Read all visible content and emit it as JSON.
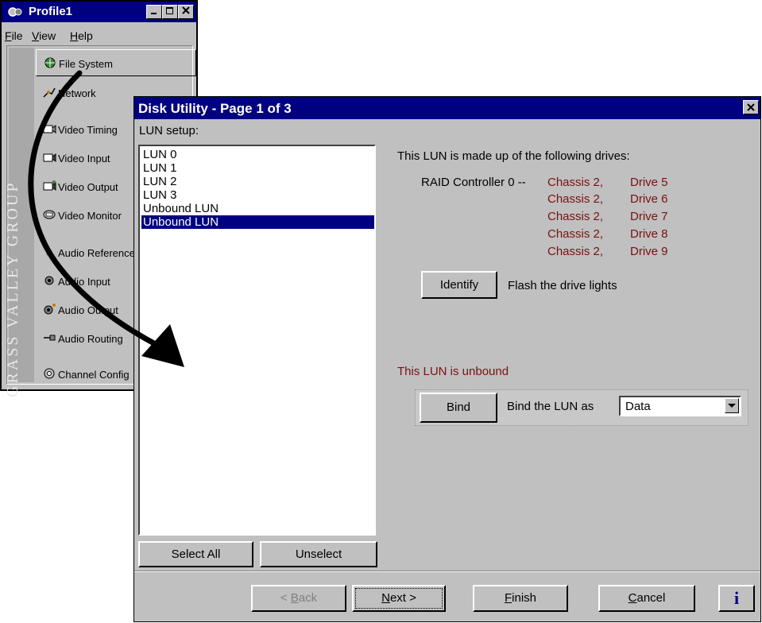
{
  "profile_window": {
    "title": "Profile1",
    "menu": [
      {
        "label": "File",
        "mnemonic": "F",
        "rest": "ile"
      },
      {
        "label": "View",
        "mnemonic": "V",
        "rest": "iew"
      },
      {
        "label": "Help",
        "mnemonic": "H",
        "rest": "elp"
      }
    ],
    "group_logo": "GRASS VALLEY GROUP",
    "nav_items": [
      {
        "label": "File System",
        "icon": "file-system-icon"
      },
      {
        "label": "Network",
        "icon": "network-icon"
      },
      {
        "label": "Video Timing",
        "icon": "video-timing-icon"
      },
      {
        "label": "Video Input",
        "icon": "video-input-icon"
      },
      {
        "label": "Video Output",
        "icon": "video-output-icon"
      },
      {
        "label": "Video Monitor",
        "icon": "video-monitor-icon"
      },
      {
        "label": "Audio Reference",
        "icon": "audio-reference-icon"
      },
      {
        "label": "Audio Input",
        "icon": "audio-input-icon"
      },
      {
        "label": "Audio Output",
        "icon": "audio-output-icon"
      },
      {
        "label": "Audio Routing",
        "icon": "audio-routing-icon"
      },
      {
        "label": "Channel Config",
        "icon": "channel-config-icon"
      }
    ]
  },
  "dialog": {
    "title": "Disk Utility - Page 1 of 3",
    "lun_setup_label": "LUN setup:",
    "lun_list": [
      "LUN 0",
      "LUN 1",
      "LUN 2",
      "LUN 3",
      "Unbound LUN",
      "Unbound LUN"
    ],
    "selected_index": 5,
    "select_all_label": "Select All",
    "unselect_label": "Unselect",
    "drives_heading": "This LUN is made up of the following drives:",
    "raid_controller": "RAID Controller 0 --",
    "drives": [
      {
        "chassis": "Chassis 2,",
        "drive": "Drive 5"
      },
      {
        "chassis": "Chassis 2,",
        "drive": "Drive 6"
      },
      {
        "chassis": "Chassis 2,",
        "drive": "Drive 7"
      },
      {
        "chassis": "Chassis 2,",
        "drive": "Drive 8"
      },
      {
        "chassis": "Chassis 2,",
        "drive": "Drive 9"
      }
    ],
    "identify_label": "Identify",
    "identify_desc": "Flash the drive lights",
    "unbound_status": "This LUN is unbound",
    "bind_label": "Bind",
    "bind_desc": "Bind the LUN as",
    "bind_type": "Data",
    "buttons": {
      "back": {
        "prefix": "< ",
        "mnemonic": "B",
        "rest": "ack"
      },
      "next": {
        "mnemonic": "N",
        "rest": "ext >"
      },
      "finish": {
        "mnemonic": "F",
        "rest": "inish"
      },
      "cancel": {
        "mnemonic": "C",
        "rest": "ancel"
      },
      "info": "i"
    }
  },
  "colors": {
    "titlebar": "#000080",
    "face": "#c0c0c0",
    "highlight": "#000080",
    "drive_text": "#7a1010"
  }
}
